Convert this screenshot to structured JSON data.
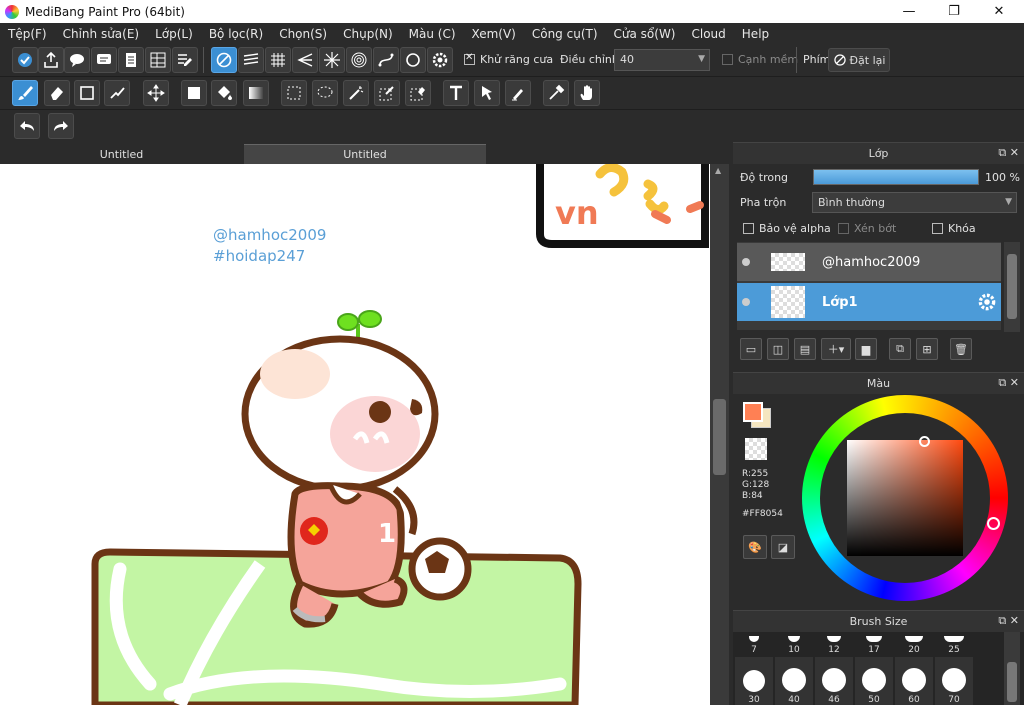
{
  "window": {
    "title": "MediBang Paint Pro (64bit)",
    "min": "—",
    "max": "❐",
    "close": "✕"
  },
  "menu": [
    "Tệp(F)",
    "Chỉnh sửa(E)",
    "Lớp(L)",
    "Bộ lọc(R)",
    "Chọn(S)",
    "Chụp(N)",
    "Màu (C)",
    "Xem(V)",
    "Công cụ(T)",
    "Cửa sổ(W)",
    "Cloud",
    "Help"
  ],
  "toolbar1": {
    "antialias_label": "Khử răng cưa",
    "adjust_label": "Điều chỉnh",
    "adjust_value": "40",
    "soft_edge_label": "Cạnh mềm",
    "key_label": "Phím",
    "reset_label": "Đặt lại"
  },
  "tabs": [
    "Untitled",
    "Untitled"
  ],
  "canvas": {
    "watermark_line1": "@hamhoc2009",
    "watermark_line2": "#hoidap247",
    "jersey_number": "1",
    "sign_text": "vn"
  },
  "layer_panel": {
    "title": "Lớp",
    "opacity_label": "Độ trong",
    "opacity_value": "100 %",
    "opacity_fraction": 1.0,
    "blend_label": "Pha trộn",
    "blend_value": "Bình thường",
    "protect_alpha": "Bảo vệ alpha",
    "clip": "Xén bớt",
    "lock": "Khóa",
    "layers": [
      {
        "name": "@hamhoc2009",
        "selected": false
      },
      {
        "name": "Lớp1",
        "selected": true
      }
    ]
  },
  "color_panel": {
    "title": "Màu",
    "r": "R:255",
    "g": "G:128",
    "b": "B:84",
    "hex": "#FF8054",
    "fg_color": "#ff8054",
    "bg_color": "#f5e6c0"
  },
  "brush_panel": {
    "title": "Brush Size",
    "row1": [
      "7",
      "10",
      "12",
      "17",
      "20",
      "25"
    ],
    "row2": [
      "30",
      "40",
      "46",
      "50",
      "60",
      "70"
    ]
  },
  "colors": {
    "accent": "#3b8fd3",
    "selected_layer": "#4c9bd8"
  }
}
